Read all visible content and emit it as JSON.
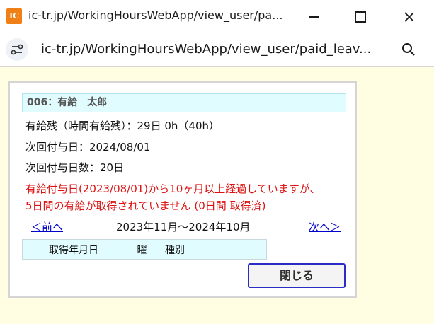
{
  "window": {
    "app_icon_text": "IC",
    "title": "ic-tr.jp/WorkingHoursWebApp/view_user/pa...",
    "minimize_icon": "minimize-icon",
    "maximize_icon": "maximize-icon",
    "close_glyph": "✕"
  },
  "addressbar": {
    "url": "ic-tr.jp/WorkingHoursWebApp/view_user/paid_leav..."
  },
  "user": {
    "header": "006：有給　太郎"
  },
  "info": {
    "remaining": "有給残（時間有給残）：29日 0h（40h）",
    "next_grant_date": "次回付与日：2024/08/01",
    "next_grant_days": "次回付与日数：20日"
  },
  "warning": {
    "line1": "有給付与日(2023/08/01)から10ヶ月以上経過していますが、",
    "line2": "5日間の有給が取得されていません (0日間 取得済)"
  },
  "nav": {
    "prev": "＜前へ",
    "period": "2023年11月～2024年10月",
    "next": "次へ＞"
  },
  "table": {
    "columns": [
      "取得年月日",
      "曜",
      "種別"
    ]
  },
  "buttons": {
    "close": "閉じる"
  },
  "colors": {
    "page_bg": "#fffde2",
    "header_bg": "#e0fcff",
    "warning": "#dd1111",
    "link": "#0000cc",
    "button_border": "#2b2bc8",
    "app_icon": "#f07f16"
  }
}
